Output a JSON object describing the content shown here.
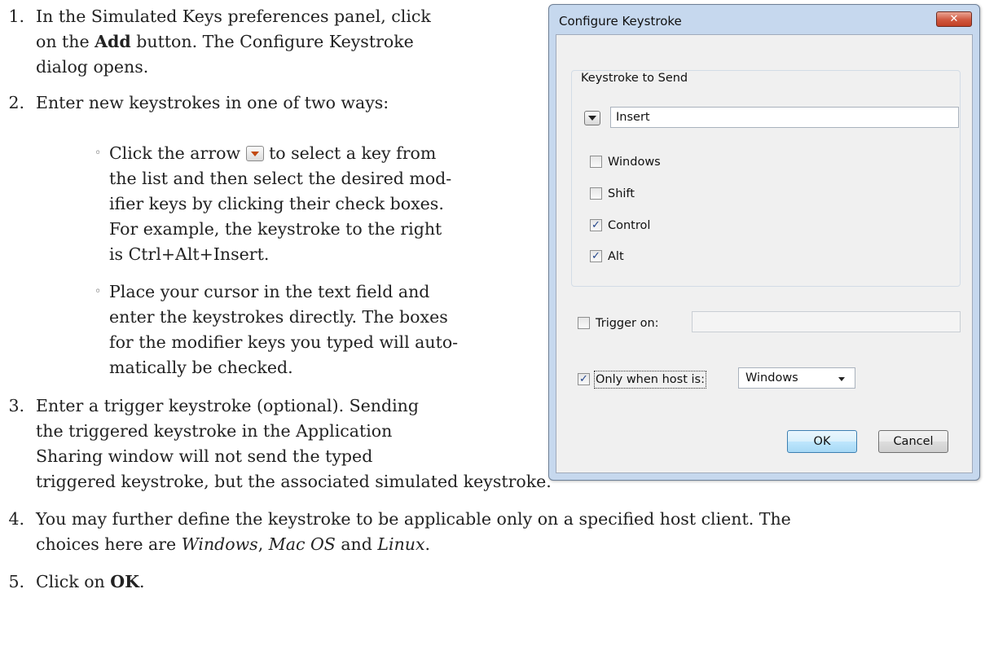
{
  "steps": [
    {
      "number": "1.",
      "lines": [
        "In the Simulated Keys preferences panel, click",
        "dialog opens."
      ],
      "line2_before": "on the ",
      "line2_bold": "Add",
      "line2_after": " button. The Configure Keystroke"
    },
    {
      "number": "2.",
      "lines": [
        "Enter new keystrokes in one of two ways:"
      ]
    },
    {
      "number": "3.",
      "lines": [
        "Enter a trigger keystroke (optional). Sending",
        "the triggered keystroke in the Application",
        "Sharing window will not send the typed",
        "triggered keystroke, but the associated simulated keystroke."
      ]
    },
    {
      "number": "4.",
      "lines": [
        "You may further define the keystroke to be applicable only on a specified host client. The"
      ],
      "line2_before": "choices here are ",
      "italic_1": "Windows",
      "sep_1": ", ",
      "italic_2": "Mac OS",
      "sep_2": " and ",
      "italic_3": "Linux",
      "line2_after": "."
    },
    {
      "number": "5.",
      "before": "Click on ",
      "bold": "OK",
      "after": "."
    }
  ],
  "sub_steps": [
    {
      "bullet": "◦",
      "line1_before": "Click the arrow ",
      "line1_after": " to select a key from",
      "lines": [
        "the list and then select the desired mod-",
        "ifier keys by clicking their check boxes.",
        "For example, the keystroke to the right",
        "is Ctrl+Alt+Insert."
      ]
    },
    {
      "bullet": "◦",
      "lines": [
        "Place your cursor in the text field and",
        "enter the keystrokes directly. The boxes",
        "for the modifier keys you typed will auto-",
        "matically be checked."
      ]
    }
  ],
  "dialog": {
    "title": "Configure Keystroke",
    "close_label": "✕",
    "group_label": "Keystroke to Send",
    "key_value": "Insert",
    "modifiers": [
      {
        "label": "Windows",
        "checked": false
      },
      {
        "label": "Shift",
        "checked": false
      },
      {
        "label": "Control",
        "checked": true
      },
      {
        "label": "Alt",
        "checked": true
      }
    ],
    "trigger_label": "Trigger on:",
    "trigger_value": "",
    "host_label": "Only when host is:",
    "host_value": "Windows",
    "ok_label": "OK",
    "cancel_label": "Cancel",
    "colors": {
      "title_bg": "#c6d8ee",
      "close_red": "#c24025",
      "check_blue": "#22448a"
    }
  }
}
